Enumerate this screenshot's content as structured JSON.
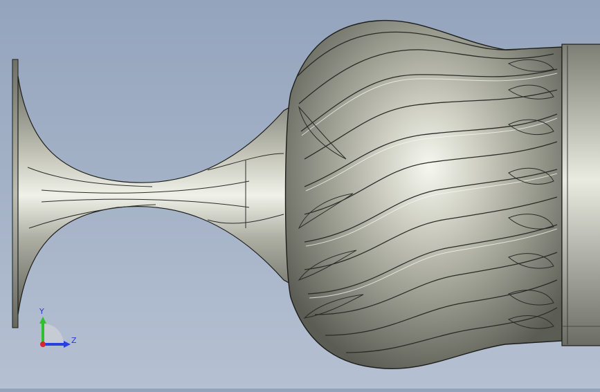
{
  "viewport": {
    "background_top": "#94a4bd",
    "background_bottom": "#b5c0d2",
    "model_base_color": "#8e8f84",
    "model_highlight_color": "#f5f6ee",
    "model_shadow_color": "#4a4b43",
    "edge_color": "#1c1d1a"
  },
  "triad": {
    "y_label": "Y",
    "z_label": "Z",
    "y_color": "#2fbf2f",
    "z_color": "#2a3fe0",
    "x_color": "#d8262c",
    "label_color": "#2b35d8"
  }
}
